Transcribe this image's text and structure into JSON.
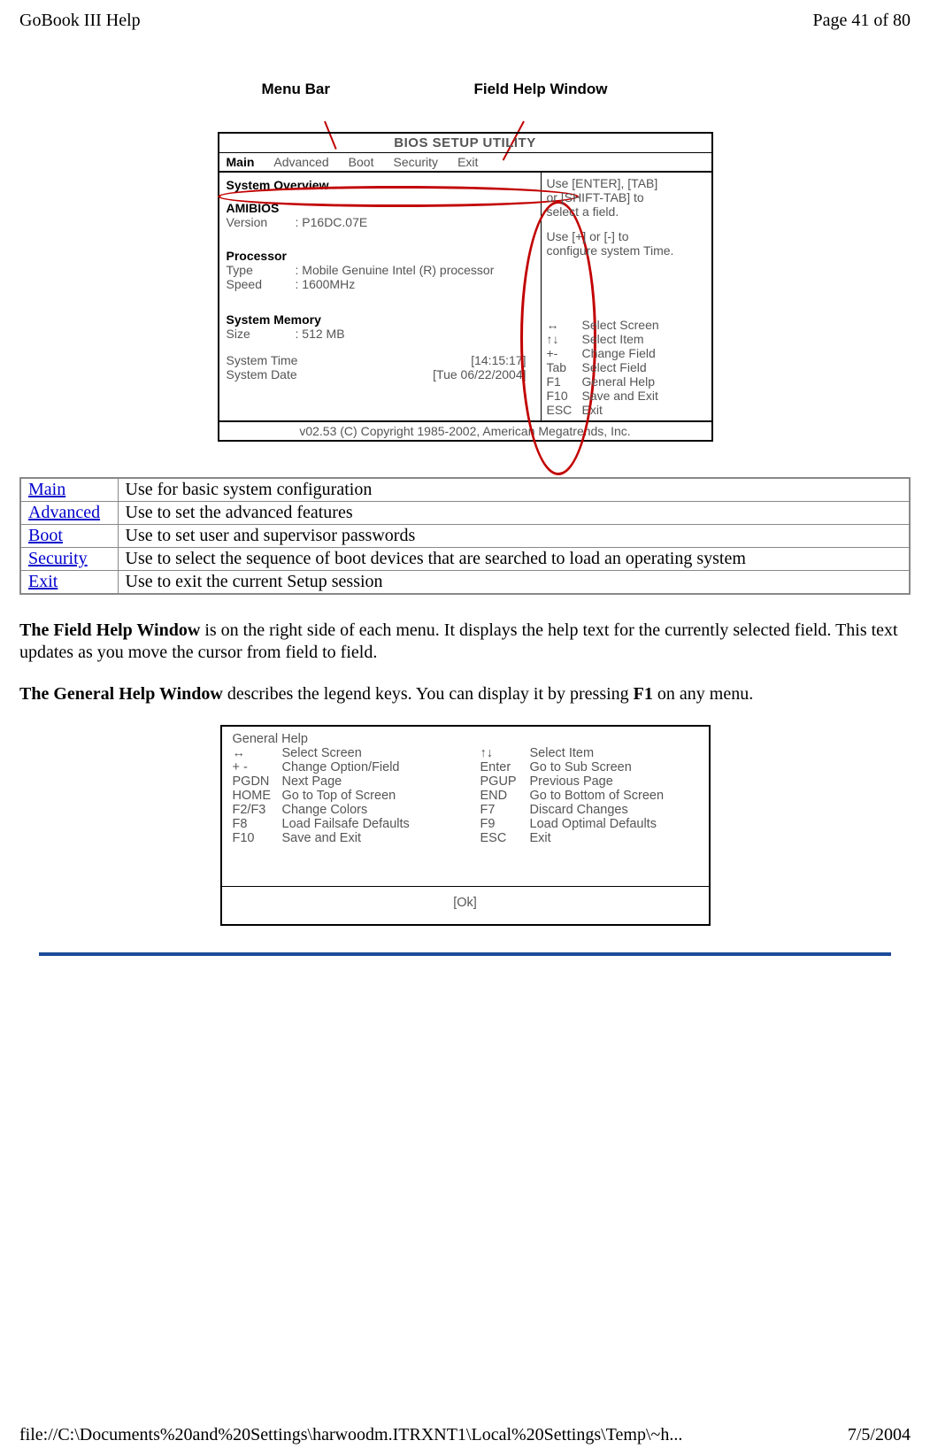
{
  "header": {
    "title": "GoBook III Help",
    "page": "Page 41 of 80"
  },
  "callouts": {
    "menu_bar": "Menu Bar",
    "field_help": "Field Help Window"
  },
  "bios": {
    "title": "BIOS   SETUP   UTILITY",
    "tabs": {
      "main": "Main",
      "advanced": "Advanced",
      "boot": "Boot",
      "security": "Security",
      "exit": "Exit"
    },
    "overview": "System Overview",
    "amibios": "AMIBIOS",
    "version_lbl": "Version",
    "version_val": ":   P16DC.07E",
    "processor": "Processor",
    "type_lbl": "Type",
    "type_val": ":   Mobile Genuine Intel (R) processor",
    "speed_lbl": "Speed",
    "speed_val": ":   1600MHz",
    "memory": "System Memory",
    "size_lbl": "Size",
    "size_val": ":   512 MB",
    "systime_lbl": "System Time",
    "systime_val": "[14:15:17]",
    "sysdate_lbl": "System Date",
    "sysdate_val": "[Tue 06/22/2004]",
    "help1": "Use [ENTER], [TAB]",
    "help2": "or [SHIFT-TAB] to",
    "help3": "select a field.",
    "help4": "Use [+] or [-] to",
    "help5": "configure system Time.",
    "nav": [
      {
        "k": "↔",
        "t": "Select Screen"
      },
      {
        "k": "↑↓",
        "t": "Select Item"
      },
      {
        "k": "+-",
        "t": "Change Field"
      },
      {
        "k": "Tab",
        "t": "Select Field"
      },
      {
        "k": "F1",
        "t": "General Help"
      },
      {
        "k": "F10",
        "t": "Save and Exit"
      },
      {
        "k": "ESC",
        "t": "Exit"
      }
    ],
    "footer": "v02.53 (C) Copyright 1985-2002, American Megatrends, Inc."
  },
  "table": [
    {
      "link": "Main",
      "desc": "Use for basic system configuration"
    },
    {
      "link": "Advanced",
      "desc": "Use to set the advanced features"
    },
    {
      "link": "Boot",
      "desc": "Use to set user and supervisor passwords"
    },
    {
      "link": "Security",
      "desc": "Use to select the sequence of boot devices that are searched to load an operating system"
    },
    {
      "link": "Exit",
      "desc": "Use to exit the current Setup session"
    }
  ],
  "para1_bold": "The Field Help Window",
  "para1_rest": " is on the right side of each menu.  It displays the help text for the currently selected field.  This text updates as you move the cursor from field to field.",
  "para2_bold": "The General Help Window",
  "para2_rest_a": " describes the legend keys. You can display it by pressing ",
  "para2_f1": "F1",
  "para2_rest_b": " on any menu.",
  "help_dialog": {
    "title": "General Help",
    "left": [
      {
        "k": "↔",
        "t": "Select Screen"
      },
      {
        "k": "+ -",
        "t": "Change Option/Field"
      },
      {
        "k": "PGDN",
        "t": "Next Page"
      },
      {
        "k": "HOME",
        "t": "Go to Top of Screen"
      },
      {
        "k": "F2/F3",
        "t": "Change Colors"
      },
      {
        "k": "F8",
        "t": "Load Failsafe Defaults"
      },
      {
        "k": "F10",
        "t": "Save and Exit"
      }
    ],
    "right": [
      {
        "k": "↑↓",
        "t": "Select Item"
      },
      {
        "k": "Enter",
        "t": "Go to Sub Screen"
      },
      {
        "k": "PGUP",
        "t": "Previous Page"
      },
      {
        "k": "END",
        "t": "Go to Bottom of Screen"
      },
      {
        "k": "F7",
        "t": "Discard Changes"
      },
      {
        "k": "F9",
        "t": "Load Optimal Defaults"
      },
      {
        "k": "ESC",
        "t": "Exit"
      }
    ],
    "ok": "[Ok]"
  },
  "footer": {
    "path": "file://C:\\Documents%20and%20Settings\\harwoodm.ITRXNT1\\Local%20Settings\\Temp\\~h...",
    "date": "7/5/2004"
  }
}
